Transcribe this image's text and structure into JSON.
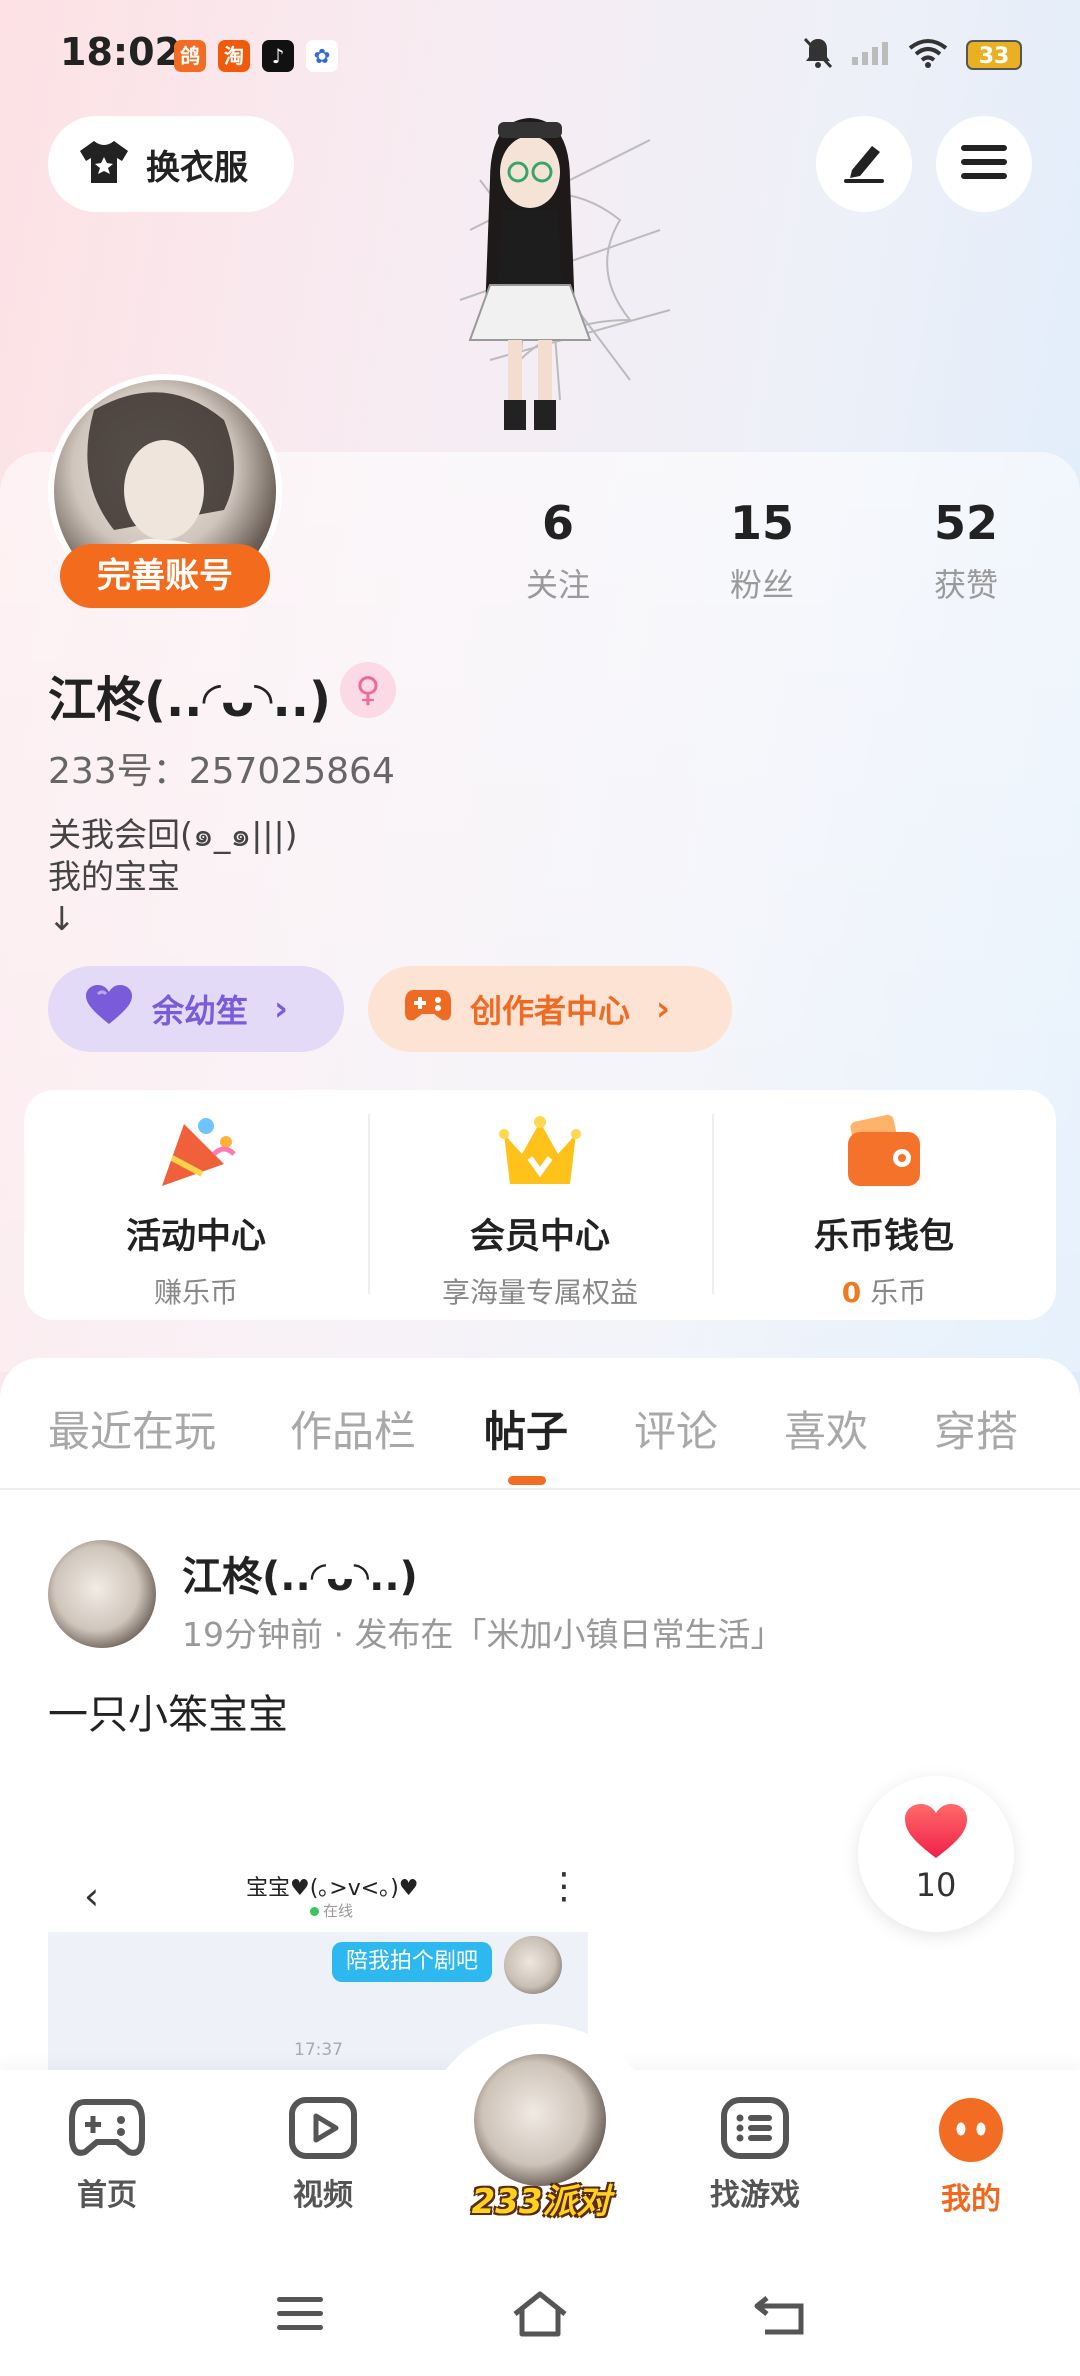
{
  "status_bar": {
    "time": "18:02",
    "apps": [
      {
        "icon": "app-orange-icon",
        "glyph": "鸽",
        "color": "#f26d23"
      },
      {
        "icon": "taobao-icon",
        "glyph": "淘",
        "color": "#f05a0a"
      },
      {
        "icon": "tiktok-icon",
        "glyph": "♪",
        "color": "#111111"
      },
      {
        "icon": "baidu-icon",
        "glyph": "✿",
        "color": "#2f6bd8"
      }
    ],
    "battery": "33"
  },
  "header": {
    "outfit_label": "换衣服",
    "edit_icon": "pen-icon",
    "menu_icon": "hamburger-icon"
  },
  "profile": {
    "complete_label": "完善账号",
    "stats": [
      {
        "num": "6",
        "label": "关注"
      },
      {
        "num": "15",
        "label": "粉丝"
      },
      {
        "num": "52",
        "label": "获赞"
      }
    ],
    "nickname": "江柊(..◜ᴗ◝..)",
    "gender_icon": "female-icon",
    "uid": "233号：257025864",
    "bio": "关我会回(๑_๑|||)\n我的宝宝\n↓",
    "wallet_pill": "余幼笙",
    "creator_pill": "创作者中心"
  },
  "services": [
    {
      "title": "活动中心",
      "sub": "赚乐币"
    },
    {
      "title": "会员中心",
      "sub": "享海量专属权益"
    },
    {
      "title": "乐币钱包",
      "sub_zero": "0",
      "sub": "乐币"
    }
  ],
  "tabs": [
    "最近在玩",
    "作品栏",
    "帖子",
    "评论",
    "喜欢",
    "穿搭"
  ],
  "active_tab": "帖子",
  "post": {
    "author": "江柊(..◜ᴗ◝..)",
    "meta": "19分钟前 · 发布在「米加小镇日常生活」",
    "text": "一只小笨宝宝",
    "image": {
      "title": "宝宝♥(｡>v<｡)♥",
      "online": "在线",
      "bubble": "陪我拍个剧吧",
      "time": "17:37"
    },
    "likes": "10"
  },
  "bottom_nav": {
    "items": [
      "首页",
      "视频",
      "找游戏",
      "我的"
    ],
    "center_label": "233派对",
    "active": "我的"
  },
  "colors": {
    "accent": "#f26d23",
    "wallet_purple": "#7a5bd9"
  }
}
